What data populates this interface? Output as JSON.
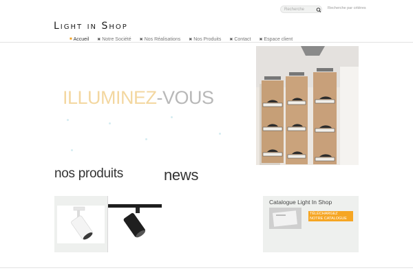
{
  "search": {
    "placeholder": "Recherche",
    "advanced_label": "Recherche par critères"
  },
  "logo": {
    "text": "Light in Shop"
  },
  "nav": {
    "items": [
      {
        "label": "Accueil",
        "active": true
      },
      {
        "label": "Notre Société",
        "active": false
      },
      {
        "label": "Nos Réalisations",
        "active": false
      },
      {
        "label": "Nos Produits",
        "active": false
      },
      {
        "label": "Contact",
        "active": false
      },
      {
        "label": "Espace client",
        "active": false
      }
    ]
  },
  "hero": {
    "highlight": "ILLUMINEZ",
    "rest": "-VOUS"
  },
  "sections": {
    "products_title": "nos produits",
    "news_title": "news"
  },
  "catalogue": {
    "title": "Catalogue Light In Shop",
    "button_label": "Téléchargez notre catalogue"
  },
  "colors": {
    "accent": "#f6a623",
    "hero_highlight": "#f3d7a0",
    "hero_rest": "#b8b8b8"
  }
}
